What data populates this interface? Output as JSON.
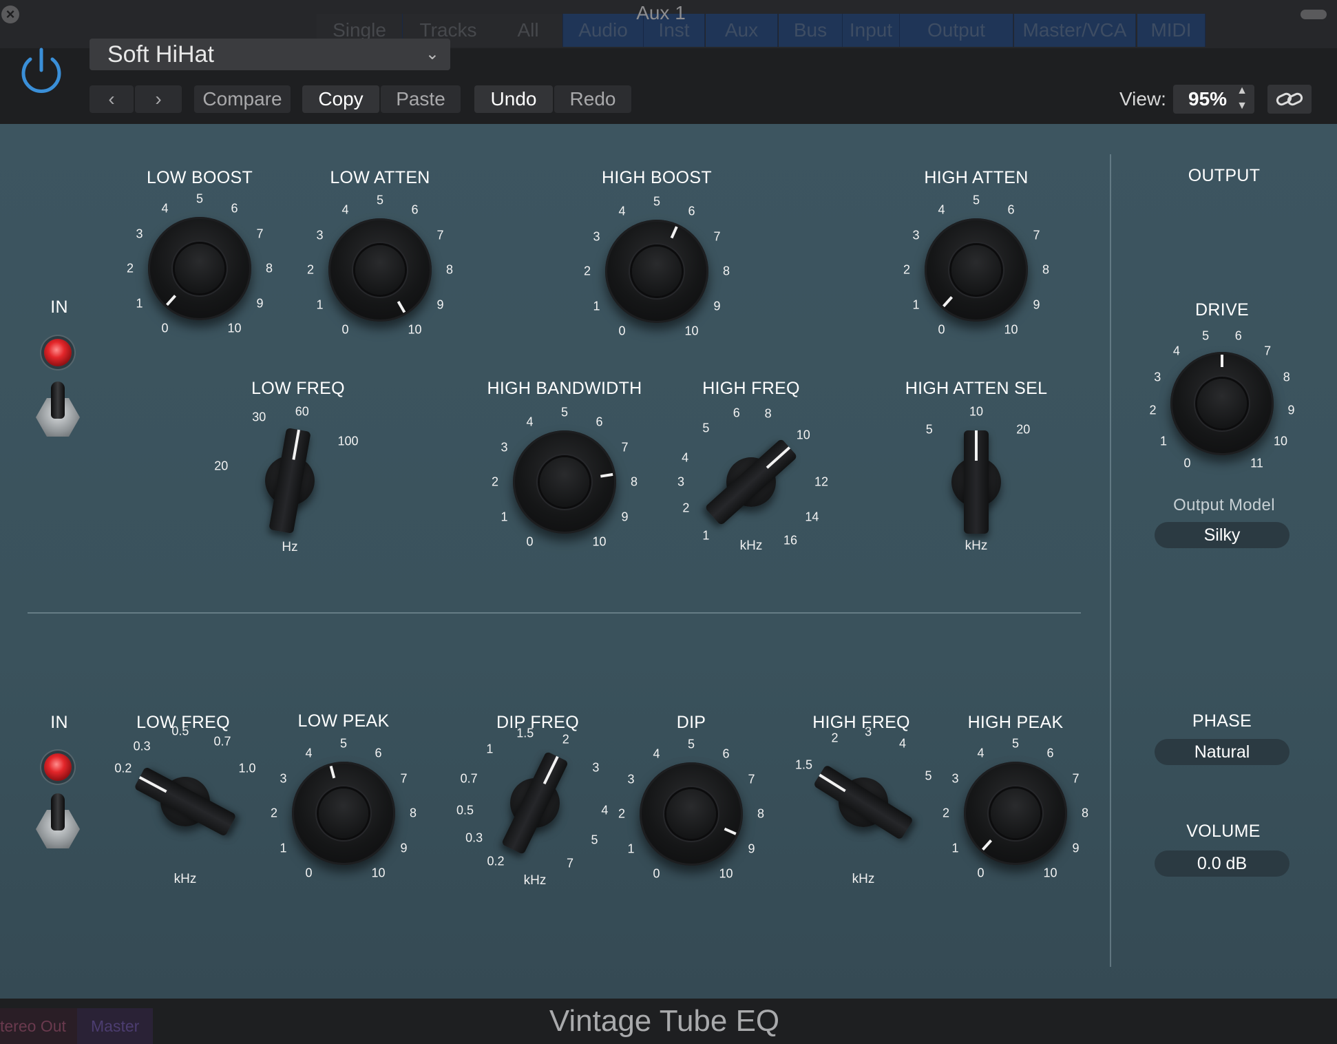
{
  "window": {
    "title": "Aux 1",
    "bg_tabs": [
      "Single",
      "Tracks",
      "All",
      "Audio",
      "Inst",
      "Aux",
      "Bus",
      "Input",
      "Output",
      "Master/VCA",
      "MIDI"
    ]
  },
  "header": {
    "preset": "Soft HiHat",
    "compare": "Compare",
    "copy": "Copy",
    "paste": "Paste",
    "undo": "Undo",
    "redo": "Redo",
    "view_label": "View:",
    "view_value": "95%"
  },
  "top_section": {
    "in_label": "IN",
    "low_boost": {
      "label": "LOW BOOST",
      "value": 0.4
    },
    "low_atten": {
      "label": "LOW ATTEN",
      "value": 10
    },
    "high_boost": {
      "label": "HIGH BOOST",
      "value": 5.8
    },
    "high_atten": {
      "label": "HIGH ATTEN",
      "value": 0.4
    },
    "low_freq": {
      "label": "LOW FREQ",
      "unit": "Hz",
      "value": "60"
    },
    "high_bandwidth": {
      "label": "HIGH BANDWIDTH",
      "value": 7.7
    },
    "high_freq": {
      "label": "HIGH FREQ",
      "unit": "kHz",
      "value": "10"
    },
    "high_atten_sel": {
      "label": "HIGH ATTEN SEL",
      "unit": "kHz",
      "value": "10"
    }
  },
  "bottom_section": {
    "in_label": "IN",
    "low_freq": {
      "label": "LOW FREQ",
      "unit": "kHz",
      "value": "0.2"
    },
    "low_peak": {
      "label": "LOW PEAK",
      "value": 4.5
    },
    "dip_freq": {
      "label": "DIP FREQ",
      "unit": "kHz",
      "value": "2"
    },
    "dip": {
      "label": "DIP",
      "value": 8.8
    },
    "high_freq": {
      "label": "HIGH FREQ",
      "unit": "kHz",
      "value": "1.5"
    },
    "high_peak": {
      "label": "HIGH PEAK",
      "value": 0.4
    }
  },
  "output": {
    "title": "OUTPUT",
    "drive": {
      "label": "DRIVE",
      "value": 5.5
    },
    "model_label": "Output Model",
    "model_value": "Silky",
    "phase_label": "PHASE",
    "phase_value": "Natural",
    "volume_label": "VOLUME",
    "volume_value": "0.0 dB"
  },
  "footer": {
    "plugin_name": "Vintage Tube EQ",
    "tab_stereo": "tereo Out",
    "tab_master": "Master"
  },
  "scales": {
    "zero_to_ten": [
      "0",
      "1",
      "2",
      "3",
      "4",
      "5",
      "6",
      "7",
      "8",
      "9",
      "10"
    ],
    "zero_to_eleven": [
      "0",
      "1",
      "2",
      "3",
      "4",
      "5",
      "6",
      "7",
      "8",
      "9",
      "10",
      "11"
    ],
    "top_low_freq": [
      "20",
      "30",
      "60",
      "100"
    ],
    "top_high_freq": [
      "1",
      "2",
      "3",
      "4",
      "5",
      "6",
      "8",
      "10",
      "12",
      "14",
      "16"
    ],
    "high_atten_sel": [
      "5",
      "10",
      "20"
    ],
    "bottom_low_freq": [
      "0.2",
      "0.3",
      "0.5",
      "0.7",
      "1.0"
    ],
    "dip_freq": [
      "0.2",
      "0.3",
      "0.5",
      "0.7",
      "1",
      "1.5",
      "2",
      "3",
      "4",
      "5",
      "7"
    ],
    "bottom_high_freq": [
      "1.5",
      "2",
      "3",
      "4",
      "5"
    ]
  },
  "colors": {
    "panel": "#3d5560",
    "led": "#e3262a",
    "accent": "#3a8fd8"
  }
}
